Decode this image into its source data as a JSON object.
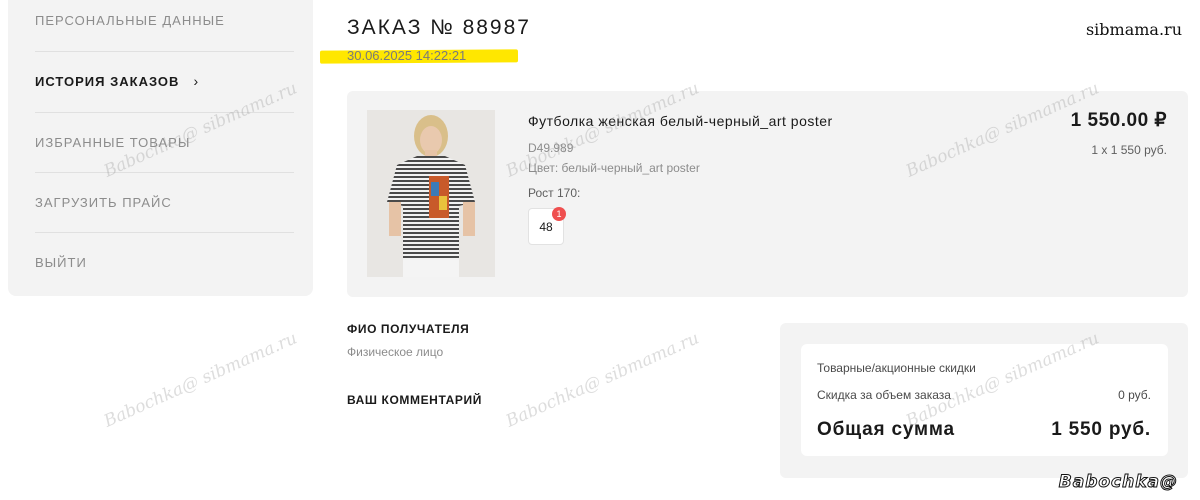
{
  "sidebar": {
    "items": [
      {
        "label": "ПЕРСОНАЛЬНЫЕ ДАННЫЕ",
        "active": false
      },
      {
        "label": "ИСТОРИЯ ЗАКАЗОВ",
        "active": true,
        "chevron": "›"
      },
      {
        "label": "ИЗБРАННЫЕ ТОВАРЫ",
        "active": false
      },
      {
        "label": "ЗАГРУЗИТЬ ПРАЙС",
        "active": false
      },
      {
        "label": "ВЫЙТИ",
        "active": false
      }
    ]
  },
  "order": {
    "title": "ЗАКАЗ № 88987",
    "date": "30.06.2025 14:22:21",
    "highlight_color": "#ffe700"
  },
  "product": {
    "name": "Футболка женская белый-черный_art poster",
    "sku": "D49.989",
    "color": "Цвет: белый-черный_art poster",
    "height": "Рост 170:",
    "size": "48",
    "size_qty_badge": "1",
    "price": "1 550.00 ₽",
    "qty_line": "1 х 1 550 руб.",
    "image": "product-photo-woman-striped-tshirt"
  },
  "recipient": {
    "label": "ФИО ПОЛУЧАТЕЛЯ",
    "value": "Физическое лицо"
  },
  "comment": {
    "label": "ВАШ КОММЕНТАРИЙ"
  },
  "summary": {
    "discounts_label": "Товарные/акционные скидки",
    "volume_discount_label": "Скидка за объем заказа",
    "volume_discount_value": "0 руб.",
    "total_label": "Общая сумма",
    "total_value": "1 550 руб."
  },
  "watermarks": {
    "brand": "sibmama.ru",
    "repeat_text": "Babochka@ sibmama.ru",
    "corner": "Babochka@"
  },
  "colors": {
    "panel_bg": "#f3f3f3",
    "badge_red": "#ef4f4f",
    "text_muted": "#8c8c8c"
  }
}
